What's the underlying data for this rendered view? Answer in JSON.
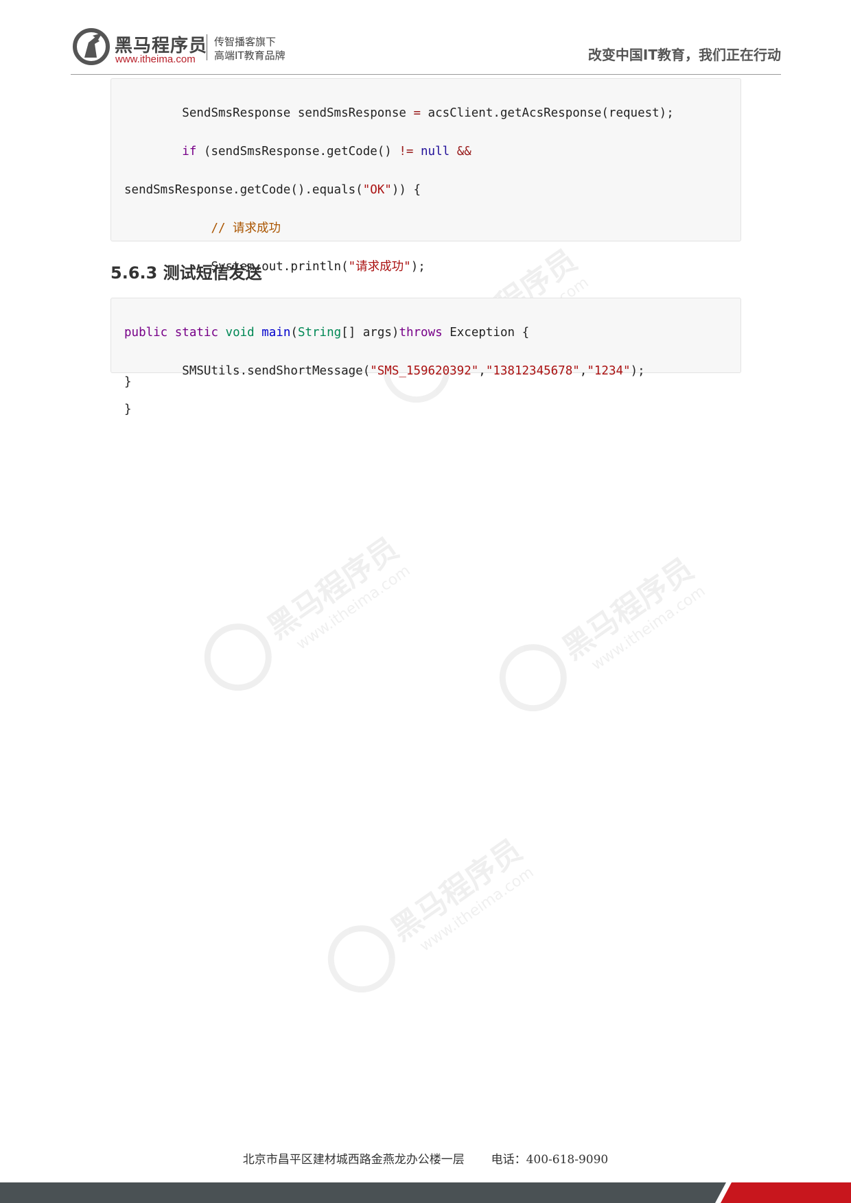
{
  "header": {
    "brand_name": "黑马程序员",
    "brand_url": "www.itheima.com",
    "slogan_line1": "传智播客旗下",
    "slogan_line2": "高端IT教育品牌",
    "tagline": "改变中国IT教育，我们正在行动"
  },
  "code_block_1": {
    "line1": {
      "a": "SendSmsResponse sendSmsResponse ",
      "op": "=",
      "b": " acsClient.getAcsResponse(request);"
    },
    "line2": {
      "kw": "if",
      "a": " (sendSmsResponse.getCode() ",
      "op": "!=",
      "sp": " ",
      "at": "null",
      "sp2": " ",
      "op2": "&&"
    },
    "line3": {
      "a": "sendSmsResponse.getCode().equals(",
      "st": "\"OK\"",
      "b": ")) {"
    },
    "line4": {
      "cm": "// 请求成功"
    },
    "line5": {
      "a": "System.out.println(",
      "st": "\"请求成功\"",
      "b": ");"
    },
    "line6": "}",
    "line7": "}",
    "line8": "}"
  },
  "section": {
    "heading": "5.6.3 测试短信发送"
  },
  "code_block_2": {
    "line1": {
      "kw1": "public",
      "kw2": "static",
      "ty1": "void",
      "fn": "main",
      "p1": "(",
      "ty2": "String",
      "p2": "[] args)",
      "kw3": "throws",
      "p3": " Exception {"
    },
    "line2": {
      "a": "SMSUtils.sendShortMessage(",
      "s1": "\"SMS_159620392\"",
      "c1": ",",
      "s2": "\"13812345678\"",
      "c2": ",",
      "s3": "\"1234\"",
      "b": ");"
    },
    "line3": "}"
  },
  "watermark": {
    "name": "黑马程序员",
    "url": "www.itheima.com"
  },
  "footer": {
    "address": "北京市昌平区建材城西路金燕龙办公楼一层",
    "phone": "电话：400-618-9090"
  },
  "colors": {
    "brand_red": "#c8161d",
    "footer_dark": "#4a5154",
    "code_bg": "#f7f7f7"
  }
}
